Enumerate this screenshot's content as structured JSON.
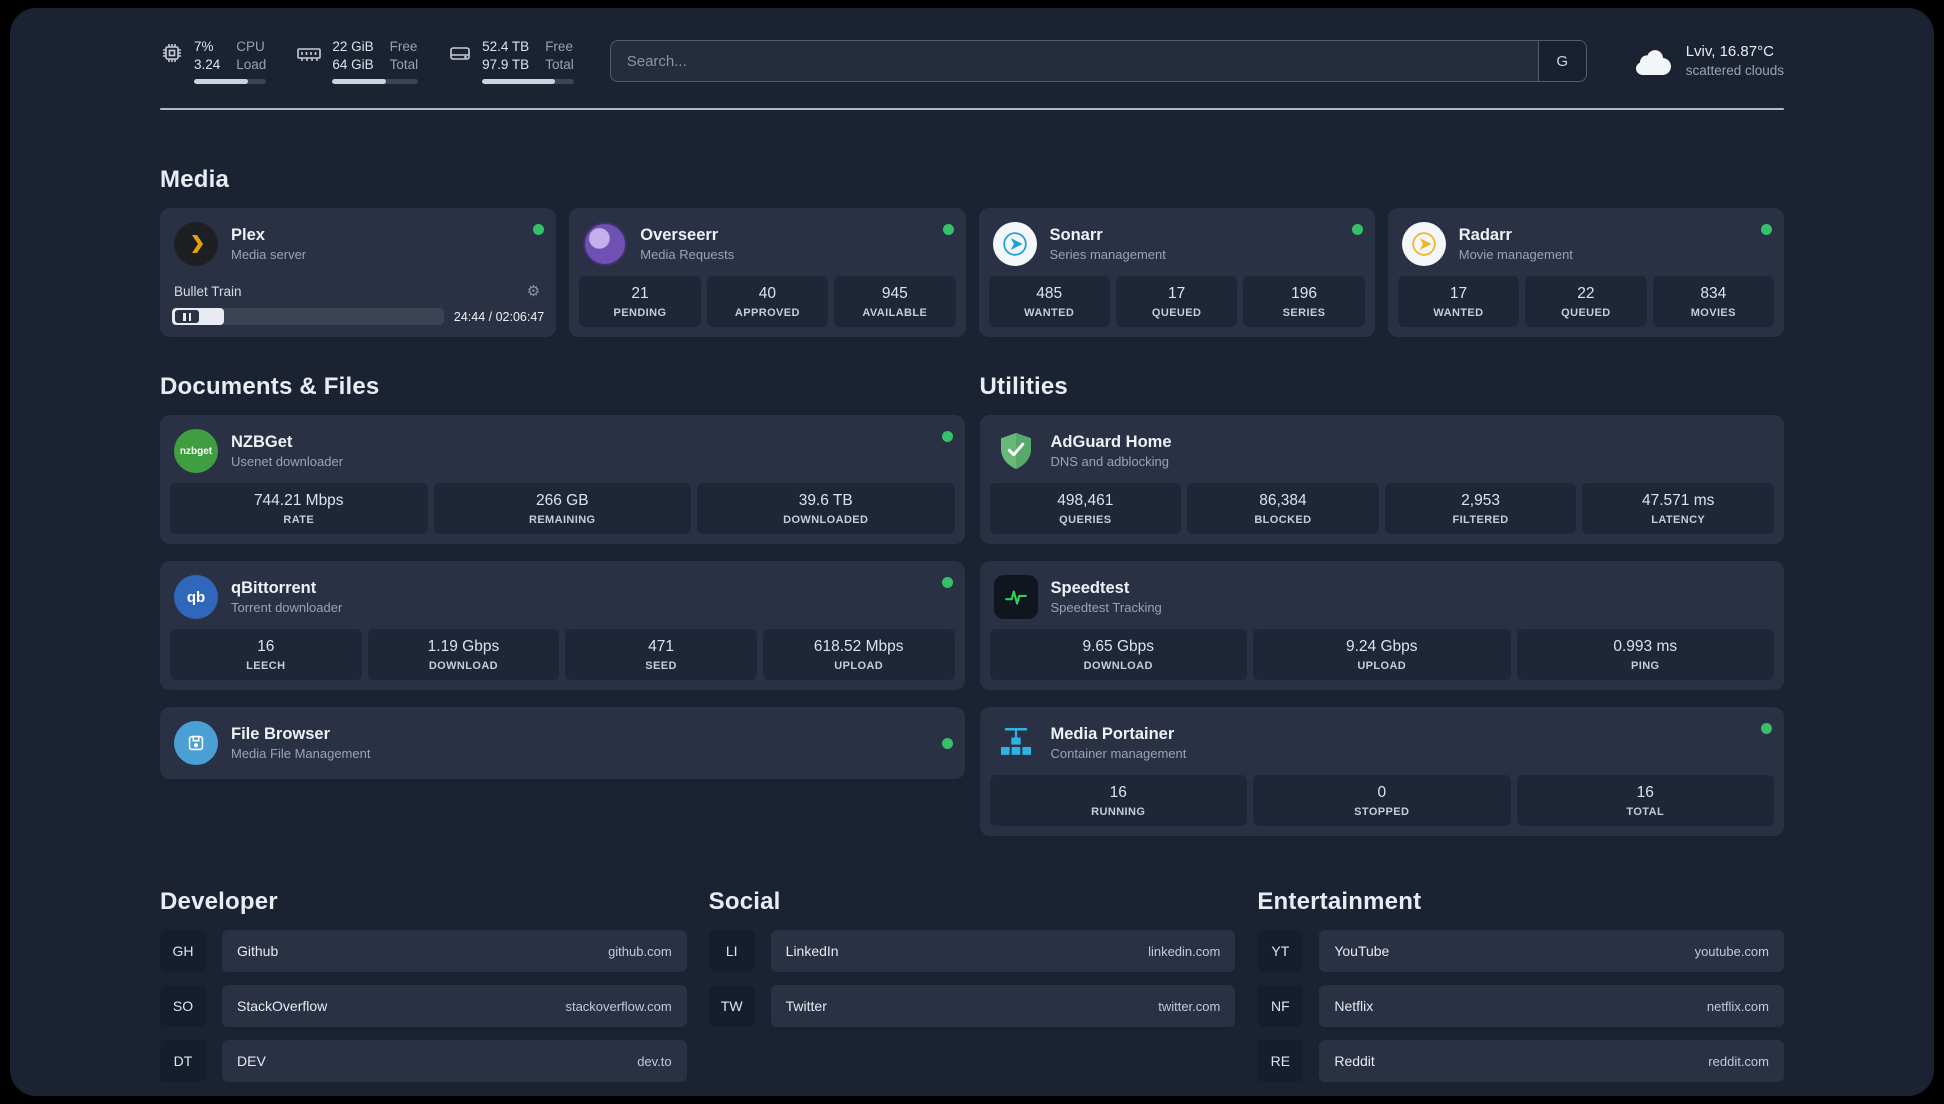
{
  "colors": {
    "background": "#1b2232",
    "card": "#2a3144",
    "stat_box": "#1e2637",
    "status_green": "#35c06a",
    "plex_yellow": "#e5a00d",
    "sonarr_blue": "#1f9fd6",
    "radarr_gold": "#f0b429",
    "nzbget_green": "#3f9e3f",
    "qbittorrent_blue": "#2f67ba",
    "adguard_green": "#68b87a",
    "speedtest_green": "#31d158",
    "portainer_blue": "#2fb1e3"
  },
  "icons": {
    "gear": "⚙"
  },
  "topbar": {
    "cpu": {
      "value1": "7%",
      "value2": "3.24",
      "label1": "CPU",
      "label2": "Load",
      "progress": 75
    },
    "memory": {
      "value1": "22 GiB",
      "value2": "64 GiB",
      "label1": "Free",
      "label2": "Total",
      "progress": 62
    },
    "disk": {
      "value1": "52.4 TB",
      "value2": "97.9 TB",
      "label1": "Free",
      "label2": "Total",
      "progress": 80
    },
    "search": {
      "placeholder": "Search...",
      "provider": "G"
    },
    "weather": {
      "location": "Lviv, 16.87°C",
      "condition": "scattered clouds"
    }
  },
  "media": {
    "title": "Media",
    "plex": {
      "name": "Plex",
      "desc": "Media server",
      "now_playing": "Bullet Train",
      "time": "24:44 / 02:06:47",
      "progress": 19
    },
    "overseerr": {
      "name": "Overseerr",
      "desc": "Media Requests",
      "stats": [
        {
          "value": "21",
          "label": "PENDING"
        },
        {
          "value": "40",
          "label": "APPROVED"
        },
        {
          "value": "945",
          "label": "AVAILABLE"
        }
      ]
    },
    "sonarr": {
      "name": "Sonarr",
      "desc": "Series management",
      "stats": [
        {
          "value": "485",
          "label": "WANTED"
        },
        {
          "value": "17",
          "label": "QUEUED"
        },
        {
          "value": "196",
          "label": "SERIES"
        }
      ]
    },
    "radarr": {
      "name": "Radarr",
      "desc": "Movie management",
      "stats": [
        {
          "value": "17",
          "label": "WANTED"
        },
        {
          "value": "22",
          "label": "QUEUED"
        },
        {
          "value": "834",
          "label": "MOVIES"
        }
      ]
    }
  },
  "documents": {
    "title": "Documents & Files",
    "nzbget": {
      "name": "NZBGet",
      "desc": "Usenet downloader",
      "logo_text": "nzbget",
      "stats": [
        {
          "value": "744.21 Mbps",
          "label": "RATE"
        },
        {
          "value": "266 GB",
          "label": "REMAINING"
        },
        {
          "value": "39.6 TB",
          "label": "DOWNLOADED"
        }
      ]
    },
    "qbittorrent": {
      "name": "qBittorrent",
      "desc": "Torrent downloader",
      "logo_text": "qb",
      "stats": [
        {
          "value": "16",
          "label": "LEECH"
        },
        {
          "value": "1.19 Gbps",
          "label": "DOWNLOAD"
        },
        {
          "value": "471",
          "label": "SEED"
        },
        {
          "value": "618.52 Mbps",
          "label": "UPLOAD"
        }
      ]
    },
    "filebrowser": {
      "name": "File Browser",
      "desc": "Media File Management"
    }
  },
  "utilities": {
    "title": "Utilities",
    "adguard": {
      "name": "AdGuard Home",
      "desc": "DNS and adblocking",
      "stats": [
        {
          "value": "498,461",
          "label": "QUERIES"
        },
        {
          "value": "86,384",
          "label": "BLOCKED"
        },
        {
          "value": "2,953",
          "label": "FILTERED"
        },
        {
          "value": "47.571 ms",
          "label": "LATENCY"
        }
      ]
    },
    "speedtest": {
      "name": "Speedtest",
      "desc": "Speedtest Tracking",
      "stats": [
        {
          "value": "9.65 Gbps",
          "label": "DOWNLOAD"
        },
        {
          "value": "9.24 Gbps",
          "label": "UPLOAD"
        },
        {
          "value": "0.993 ms",
          "label": "PING"
        }
      ]
    },
    "portainer": {
      "name": "Media Portainer",
      "desc": "Container management",
      "stats": [
        {
          "value": "16",
          "label": "RUNNING"
        },
        {
          "value": "0",
          "label": "STOPPED"
        },
        {
          "value": "16",
          "label": "TOTAL"
        }
      ]
    }
  },
  "bookmarks": {
    "developer": {
      "title": "Developer",
      "items": [
        {
          "abbr": "GH",
          "name": "Github",
          "domain": "github.com"
        },
        {
          "abbr": "SO",
          "name": "StackOverflow",
          "domain": "stackoverflow.com"
        },
        {
          "abbr": "DT",
          "name": "DEV",
          "domain": "dev.to"
        }
      ]
    },
    "social": {
      "title": "Social",
      "items": [
        {
          "abbr": "LI",
          "name": "LinkedIn",
          "domain": "linkedin.com"
        },
        {
          "abbr": "TW",
          "name": "Twitter",
          "domain": "twitter.com"
        }
      ]
    },
    "entertainment": {
      "title": "Entertainment",
      "items": [
        {
          "abbr": "YT",
          "name": "YouTube",
          "domain": "youtube.com"
        },
        {
          "abbr": "NF",
          "name": "Netflix",
          "domain": "netflix.com"
        },
        {
          "abbr": "RE",
          "name": "Reddit",
          "domain": "reddit.com"
        }
      ]
    }
  }
}
